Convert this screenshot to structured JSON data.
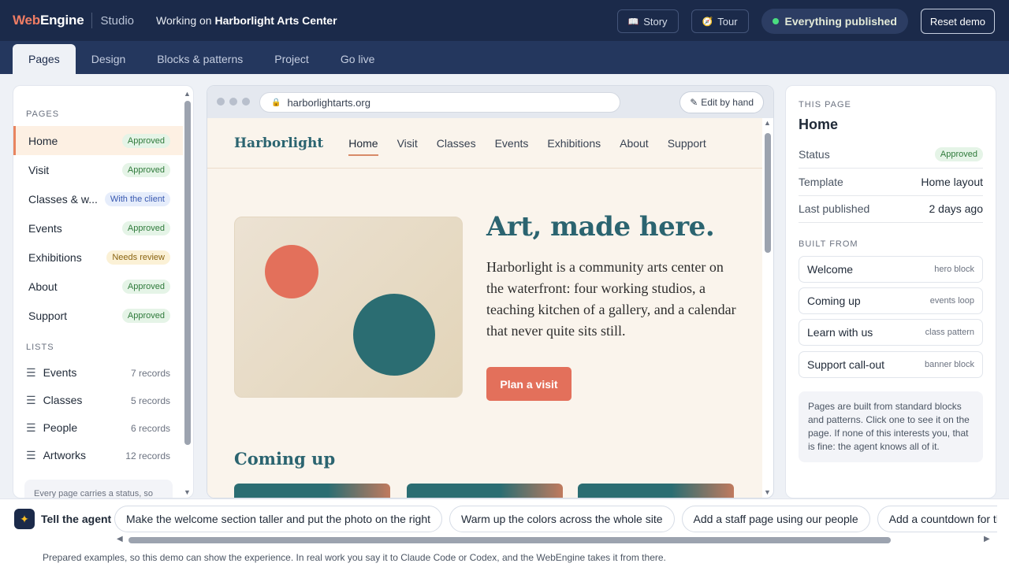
{
  "topbar": {
    "brand_web": "Web",
    "brand_engine": "Engine",
    "studio": "Studio",
    "working_prefix": "Working on",
    "project_name": "Harborlight Arts Center",
    "story_label": "Story",
    "story_icon": "book-icon",
    "tour_label": "Tour",
    "tour_icon": "compass-icon",
    "published_label": "Everything published",
    "reset_label": "Reset demo"
  },
  "tabs": [
    {
      "label": "Pages",
      "active": true
    },
    {
      "label": "Design"
    },
    {
      "label": "Blocks & patterns"
    },
    {
      "label": "Project"
    },
    {
      "label": "Go live"
    }
  ],
  "sidebar": {
    "pages_heading": "PAGES",
    "pages": [
      {
        "name": "Home",
        "status": "Approved",
        "active": true
      },
      {
        "name": "Visit",
        "status": "Approved"
      },
      {
        "name": "Classes & w...",
        "status": "With the client"
      },
      {
        "name": "Events",
        "status": "Approved"
      },
      {
        "name": "Exhibitions",
        "status": "Needs review"
      },
      {
        "name": "About",
        "status": "Approved"
      },
      {
        "name": "Support",
        "status": "Approved"
      }
    ],
    "lists_heading": "LISTS",
    "lists": [
      {
        "name": "Events",
        "records": "7 records"
      },
      {
        "name": "Classes",
        "records": "5 records"
      },
      {
        "name": "People",
        "records": "6 records"
      },
      {
        "name": "Artworks",
        "records": "12 records"
      }
    ],
    "note": "Every page carries a status, so"
  },
  "preview": {
    "url": "harborlightarts.org",
    "edit_label": "Edit by hand",
    "site": {
      "logo": "Harborlight",
      "nav": [
        "Home",
        "Visit",
        "Classes",
        "Events",
        "Exhibitions",
        "About",
        "Support"
      ],
      "hero_title": "Art, made here.",
      "hero_text": "Harborlight is a community arts center on the waterfront: four working studios, a teaching kitchen of a gallery, and a calendar that never quite sits still.",
      "cta": "Plan a visit",
      "section_title": "Coming up"
    }
  },
  "rpanel": {
    "label": "THIS PAGE",
    "title": "Home",
    "status_key": "Status",
    "status_val": "Approved",
    "template_key": "Template",
    "template_val": "Home layout",
    "published_key": "Last published",
    "published_val": "2 days ago",
    "built_label": "BUILT FROM",
    "blocks": [
      {
        "name": "Welcome",
        "type": "hero block"
      },
      {
        "name": "Coming up",
        "type": "events loop"
      },
      {
        "name": "Learn with us",
        "type": "class pattern"
      },
      {
        "name": "Support call-out",
        "type": "banner block"
      }
    ],
    "note": "Pages are built from standard blocks and patterns. Click one to see it on the page. If none of this interests you, that is fine: the agent knows all of it."
  },
  "agent": {
    "label": "Tell the agent",
    "chips": [
      "Make the welcome section taller and put the photo on the right",
      "Warm up the colors across the whole site",
      "Add a staff page using our people",
      "Add a countdown for the print fai"
    ],
    "footer": "Prepared examples, so this demo can show the experience. In real work you say it to Claude Code or Codex, and the WebEngine takes it from there."
  },
  "colors": {
    "topbar": "#1b2a4a",
    "accent": "#e3705b",
    "teal": "#2b6470",
    "approved": "#2f7a3b"
  }
}
